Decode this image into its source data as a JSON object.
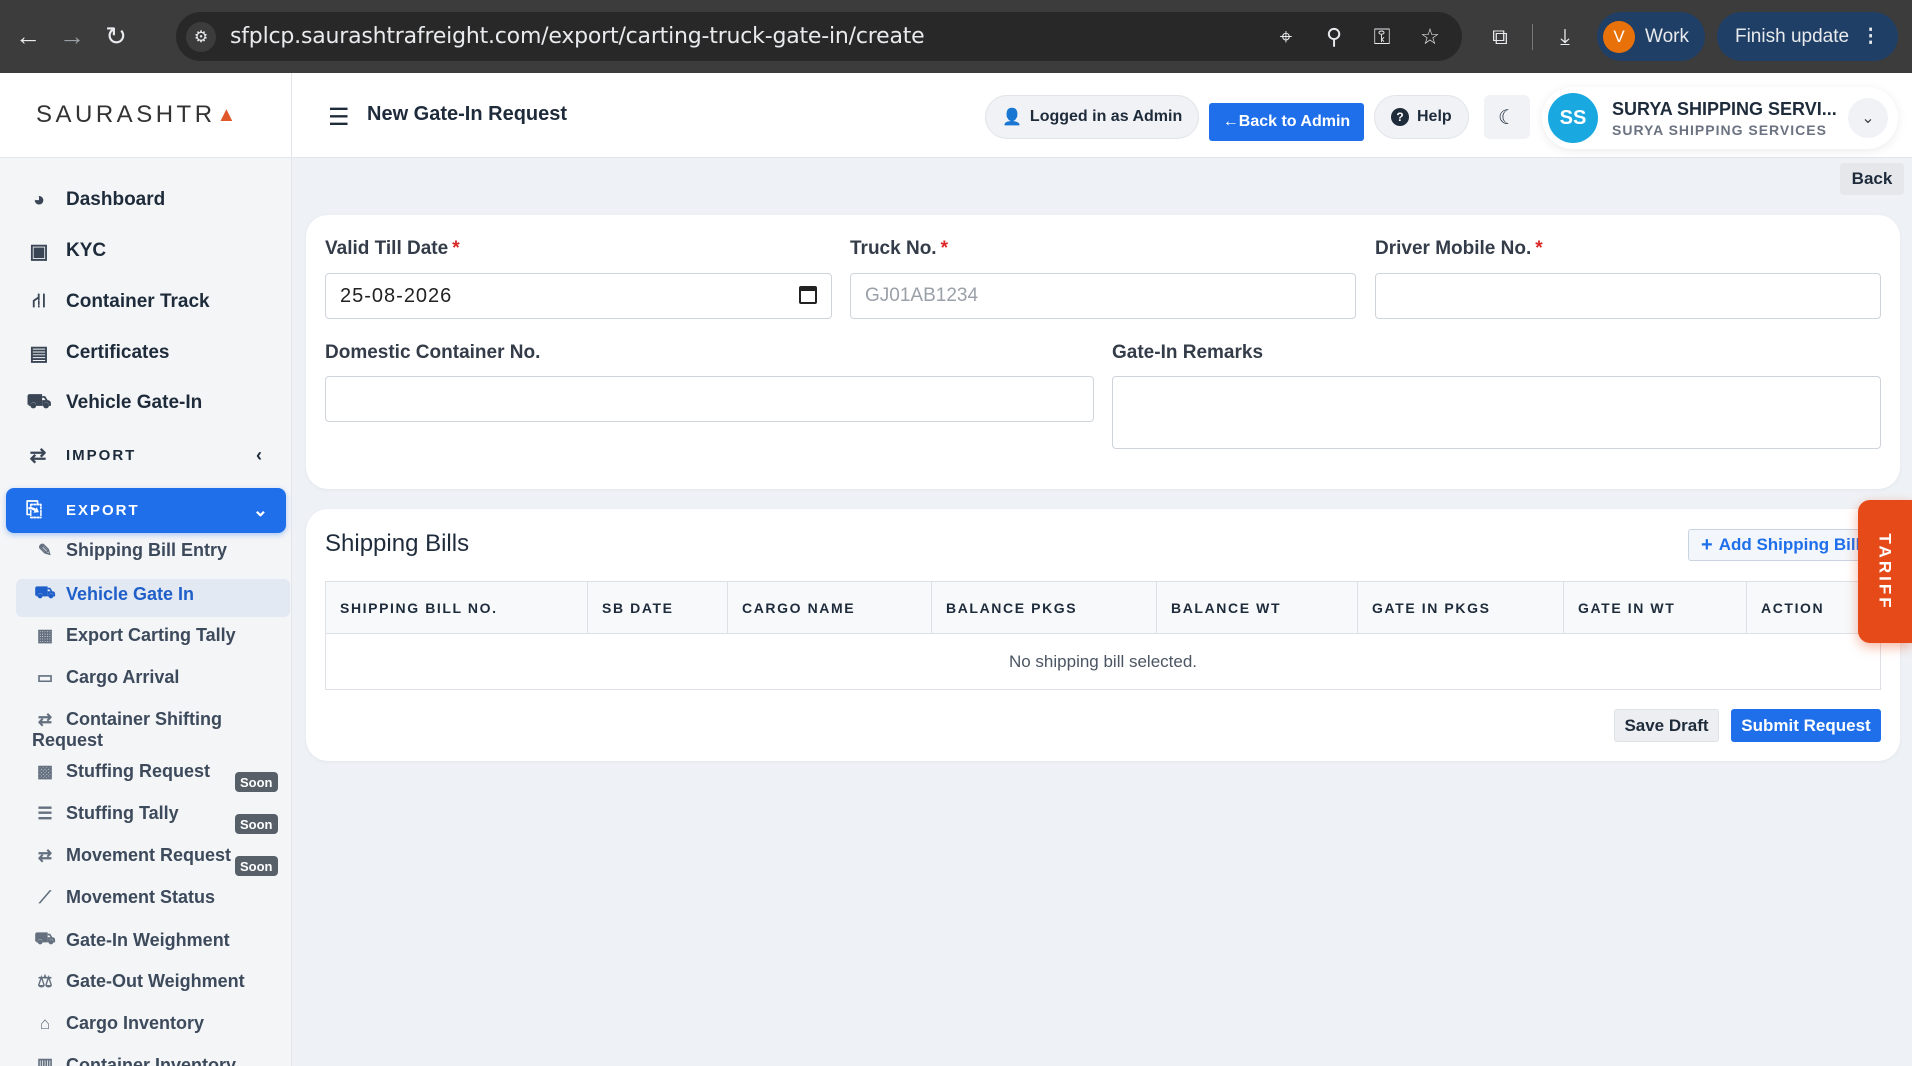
{
  "browser": {
    "url": "sfplcp.saurashtrafreight.com/export/carting-truck-gate-in/create",
    "profile_initial": "V",
    "profile_label": "Work",
    "update_label": "Finish update"
  },
  "sidebar": {
    "brand": "SAURASHTR",
    "brand_mark": "▲",
    "items": [
      {
        "label": "Dashboard",
        "icon": "dashboard-icon"
      },
      {
        "label": "KYC",
        "icon": "id-card-icon"
      },
      {
        "label": "Container Track",
        "icon": "route-icon"
      },
      {
        "label": "Certificates",
        "icon": "certificate-icon"
      },
      {
        "label": "Vehicle Gate-In",
        "icon": "truck-icon"
      }
    ],
    "import_label": "IMPORT",
    "export_label": "EXPORT",
    "export_items": [
      {
        "label": "Shipping Bill Entry",
        "icon": "edit-icon"
      },
      {
        "label": "Vehicle Gate In",
        "icon": "truck-icon",
        "active": true
      },
      {
        "label": "Export Carting Tally",
        "icon": "clipboard-icon"
      },
      {
        "label": "Cargo Arrival",
        "icon": "box-open-icon"
      },
      {
        "label": "Container Shifting",
        "label2": "Request",
        "icon": "shift-icon"
      },
      {
        "label": "Stuffing Request",
        "icon": "clipboard-check-icon",
        "badge": "Soon"
      },
      {
        "label": "Stuffing Tally",
        "icon": "list-icon",
        "badge": "Soon"
      },
      {
        "label": "Movement Request",
        "icon": "shift-icon",
        "badge": "Soon"
      },
      {
        "label": "Movement Status",
        "icon": "chart-line-icon"
      },
      {
        "label": "Gate-In Weighment",
        "icon": "truck-icon"
      },
      {
        "label": "Gate-Out Weighment",
        "icon": "scale-icon"
      },
      {
        "label": "Cargo Inventory",
        "icon": "warehouse-icon"
      },
      {
        "label": "Container Inventory",
        "icon": "container-icon"
      }
    ]
  },
  "header": {
    "title": "New Gate-In Request",
    "logged_in": "Logged in as Admin",
    "back_admin": "←Back to Admin",
    "help": "Help",
    "user_initials": "SS",
    "user_name": "SURYA SHIPPING SERVI...",
    "user_org": "SURYA SHIPPING SERVICES"
  },
  "back_label": "Back",
  "form": {
    "valid_till_label": "Valid Till Date",
    "valid_till_value": "25-08-2026",
    "truck_label": "Truck No.",
    "truck_placeholder": "GJ01AB1234",
    "driver_label": "Driver Mobile No.",
    "driver_value": "",
    "container_label": "Domestic Container No.",
    "container_value": "",
    "remarks_label": "Gate-In Remarks",
    "remarks_value": "",
    "required_mark": "*"
  },
  "shipping_bills": {
    "title": "Shipping Bills",
    "add_label": "Add Shipping Bill",
    "add_icon": "+",
    "columns": [
      "SHIPPING BILL NO.",
      "SB DATE",
      "CARGO NAME",
      "BALANCE PKGS",
      "BALANCE WT",
      "GATE IN PKGS",
      "GATE IN WT",
      "ACTION"
    ],
    "empty_text": "No shipping bill selected.",
    "save_draft": "Save Draft",
    "submit": "Submit Request"
  },
  "tariff_label": "TARIFF",
  "colors": {
    "primary": "#1f6feb",
    "tariff": "#e64a19",
    "required": "#dc2626",
    "avatar": "#1aa8e0"
  }
}
